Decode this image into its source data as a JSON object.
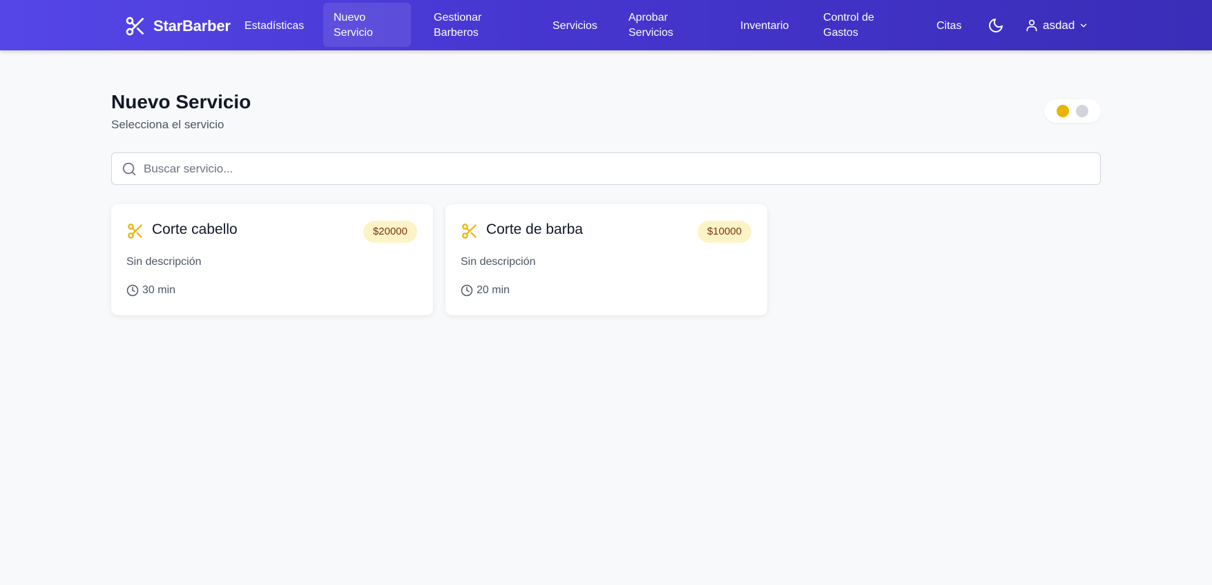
{
  "app": {
    "brand": "StarBarber"
  },
  "nav": {
    "items": [
      {
        "label": "Estadísticas"
      },
      {
        "label": "Nuevo Servicio"
      },
      {
        "label": "Gestionar Barberos"
      },
      {
        "label": "Servicios"
      },
      {
        "label": "Aprobar Servicios"
      },
      {
        "label": "Inventario"
      },
      {
        "label": "Control de Gastos"
      },
      {
        "label": "Citas"
      }
    ],
    "active": "Nuevo Servicio",
    "theme_icon": "moon-icon",
    "user": {
      "name": "asdad",
      "icon": "user-icon",
      "dropdown_icon": "chevron-down-icon"
    }
  },
  "page": {
    "title": "Nuevo Servicio",
    "subtitle": "Selecciona el servicio"
  },
  "search": {
    "placeholder": "Buscar servicio...",
    "value": "",
    "icon": "search-icon"
  },
  "toggle": {
    "active_color": "#eab308",
    "inactive_color": "#d1d5db"
  },
  "services": [
    {
      "name": "Corte cabello",
      "price": "$20000",
      "description": "Sin descripción",
      "duration": "30 min",
      "icon": "scissors-icon"
    },
    {
      "name": "Corte de barba",
      "price": "$10000",
      "description": "Sin descripción",
      "duration": "20 min",
      "icon": "scissors-icon"
    }
  ],
  "colors": {
    "nav_gradient_start": "#5546e8",
    "nav_gradient_end": "#3a2db8",
    "accent": "#eab308",
    "badge_bg": "#fef3c7",
    "badge_text": "#78350f"
  }
}
